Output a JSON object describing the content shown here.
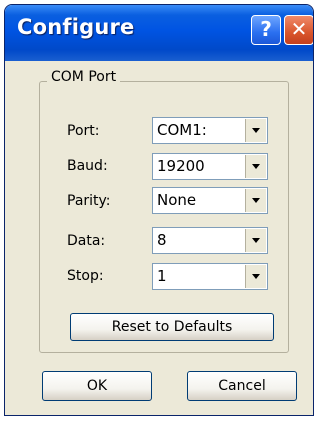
{
  "window": {
    "title": "Configure",
    "help_glyph": "?",
    "close_glyph": "✕"
  },
  "com_port": {
    "group_label": "COM Port",
    "fields": [
      {
        "label": "Port:",
        "value": "COM1:"
      },
      {
        "label": "Baud:",
        "value": "19200"
      },
      {
        "label": "Parity:",
        "value": "None"
      },
      {
        "label": "Data:",
        "value": "8"
      },
      {
        "label": "Stop:",
        "value": "1"
      }
    ],
    "reset_label": "Reset to Defaults"
  },
  "buttons": {
    "ok_label": "OK",
    "cancel_label": "Cancel"
  },
  "colors": {
    "titlebar": "#0054e3",
    "dialog_bg": "#ece9d8",
    "close_button": "#d9552c"
  }
}
